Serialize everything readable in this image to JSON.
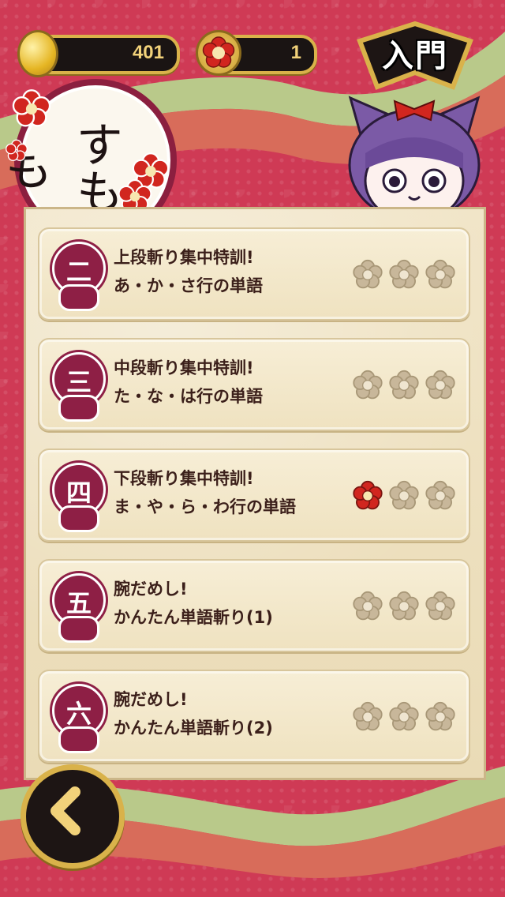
{
  "currency": {
    "coins": "401",
    "flowers": "1"
  },
  "rank": {
    "label": "入門"
  },
  "character": {
    "name": "すもも"
  },
  "stages": [
    {
      "num": "二",
      "line1": "上段斬り集中特訓!",
      "line2": "あ・か・さ行の単語",
      "stars_earned": 0,
      "stars_total": 3
    },
    {
      "num": "三",
      "line1": "中段斬り集中特訓!",
      "line2": "た・な・は行の単語",
      "stars_earned": 0,
      "stars_total": 3
    },
    {
      "num": "四",
      "line1": "下段斬り集中特訓!",
      "line2": "ま・や・ら・わ行の単語",
      "stars_earned": 1,
      "stars_total": 3
    },
    {
      "num": "五",
      "line1": "腕だめし!",
      "line2": "かんたん単語斬り(1)",
      "stars_earned": 0,
      "stars_total": 3
    },
    {
      "num": "六",
      "line1": "腕だめし!",
      "line2": "かんたん単語斬り(2)",
      "stars_earned": 0,
      "stars_total": 3
    }
  ],
  "colors": {
    "accent": "#8e1f45",
    "gold": "#d9b24a",
    "star_on": "#d1261f",
    "star_off": "#c8b79a"
  },
  "icons": {
    "back": "chevron-left-icon",
    "coin": "coin-icon",
    "flower": "flower-icon"
  }
}
